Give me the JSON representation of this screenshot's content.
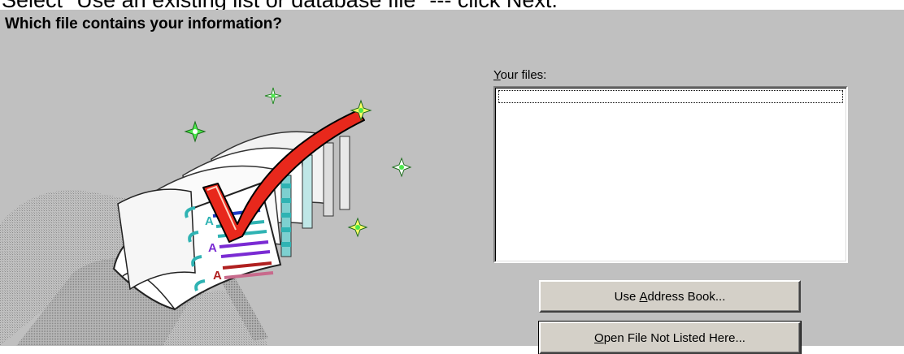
{
  "caption": "Select \"Use an existing list or database file\" --- click Next.",
  "wizard": {
    "heading": "Which file contains your information?",
    "files_label": {
      "accel": "Y",
      "rest": "our files:"
    },
    "files": [],
    "buttons": {
      "address_book": {
        "before": "Use ",
        "accel": "A",
        "after": "ddress Book..."
      },
      "open_file": {
        "before": "",
        "accel": "O",
        "after": "pen File Not Listed Here..."
      }
    }
  },
  "colors": {
    "dialog_bg": "#c0c0c0",
    "button_face": "#d4d0c8",
    "checkmark_red": "#e8281c",
    "tab_teal": "#2fb3b3",
    "sparkle_green": "#4ce84c"
  },
  "icons": [
    "address-book-checkmark-illustration",
    "sparkle-icon"
  ]
}
